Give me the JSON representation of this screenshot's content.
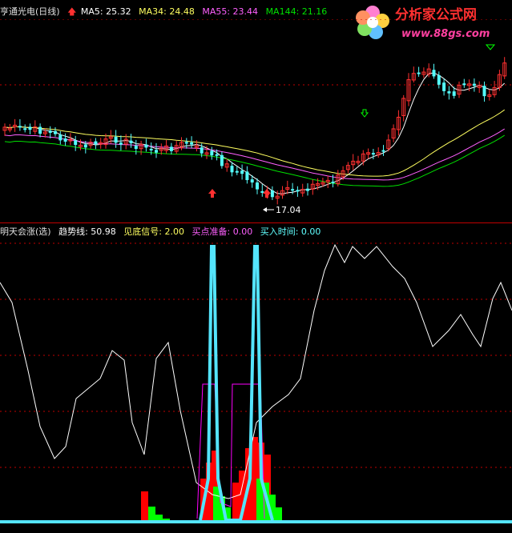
{
  "colors": {
    "background": "#000000",
    "up_candle": "#ff3030",
    "down_candle": "#54fcfc",
    "ma5": "#ffffff",
    "ma34": "#ffff60",
    "ma55": "#ff60ff",
    "ma144": "#00e000",
    "divider": "#c00000",
    "trend_line": "#ffffff",
    "bottom_signal": "#ff00ff",
    "buy_ready": "#ff0000",
    "buy_time": "#00ff00",
    "spike": "#54e4fc"
  },
  "main_header": {
    "title": "亨通光电(日线)",
    "ma5_label": "MA5: 25.32",
    "ma34_label": "MA34: 24.48",
    "ma55_label": "MA55: 23.44",
    "ma144_label": "MA144: 21.16"
  },
  "low_marker_label": "17.04",
  "watermark": {
    "title": "分析家公式网",
    "url": "www.88gs.com"
  },
  "indicator_header": {
    "name": "明天会涨(选)",
    "trend_label": "趋势线: 50.98",
    "bottom_signal_label": "见底信号: 2.00",
    "buy_ready_label": "买点准备: 0.00",
    "buy_time_label": "买入时间: 0.00"
  }
}
